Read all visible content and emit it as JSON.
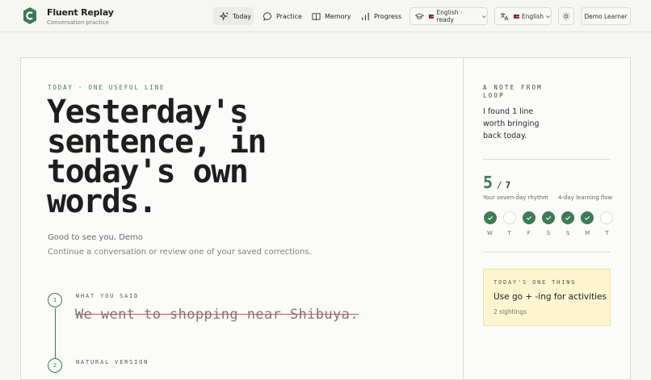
{
  "app": {
    "name": "Fluent Replay",
    "tagline": "Conversation practice"
  },
  "nav": {
    "today": "Today",
    "practice": "Practice",
    "memory": "Memory",
    "progress": "Progress",
    "active": "Today"
  },
  "controls": {
    "voice": "English · ready",
    "language": "English",
    "user": "Demo Learner"
  },
  "main": {
    "eyebrow": "TODAY · ONE USEFUL LINE",
    "headline": "Yesterday's sentence, in today's own words.",
    "greeting": "Good to see you, Demo",
    "subtitle": "Continue a conversation or review one of your saved corrections.",
    "steps": [
      {
        "number": "1",
        "label": "WHAT YOU SAID",
        "text": "We went to shopping near Shibuya."
      },
      {
        "number": "2",
        "label": "NATURAL VERSION"
      }
    ]
  },
  "side": {
    "note_eyebrow": "A NOTE FROM LOOP",
    "note_text": "I found 1 line worth bringing back today.",
    "streak": {
      "count": "5",
      "separator": "/",
      "total": "7",
      "rhythm_label": "Your seven-day rhythm",
      "flow_label": "4-day learning flow"
    },
    "days": [
      {
        "letter": "W",
        "done": true
      },
      {
        "letter": "T",
        "done": false
      },
      {
        "letter": "F",
        "done": true
      },
      {
        "letter": "S",
        "done": true
      },
      {
        "letter": "S",
        "done": true
      },
      {
        "letter": "M",
        "done": true
      },
      {
        "letter": "T",
        "done": false
      }
    ],
    "thing": {
      "eyebrow": "TODAY'S ONE THING",
      "title": "Use go + -ing for activities",
      "meta": "2 sightings"
    }
  },
  "colors": {
    "accent": "#3d7a56",
    "highlight": "#fcf5cf",
    "strike": "#c05a4e"
  }
}
